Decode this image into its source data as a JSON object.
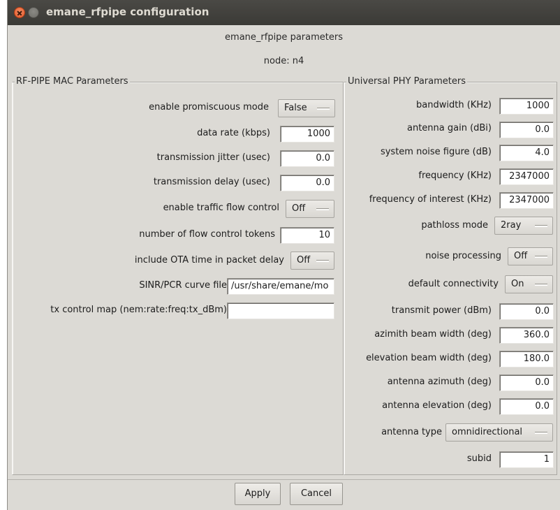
{
  "window": {
    "title": "emane_rfpipe configuration"
  },
  "header": {
    "subtitle": "emane_rfpipe parameters",
    "node": "node: n4"
  },
  "mac": {
    "title": "RF-PIPE MAC Parameters",
    "fields": [
      {
        "label": "enable promiscuous mode",
        "type": "menu",
        "value": "False"
      },
      {
        "label": "data rate (kbps)",
        "type": "entry",
        "value": "1000"
      },
      {
        "label": "transmission jitter (usec)",
        "type": "entry",
        "value": "0.0"
      },
      {
        "label": "transmission delay (usec)",
        "type": "entry",
        "value": "0.0"
      },
      {
        "label": "enable traffic flow control",
        "type": "menu",
        "value": "Off"
      },
      {
        "label": "number of flow control tokens",
        "type": "entry",
        "value": "10"
      },
      {
        "label": "include OTA time in packet delay",
        "type": "menu",
        "value": "Off"
      },
      {
        "label": "SINR/PCR curve file",
        "type": "entry",
        "value": "/usr/share/emane/mo"
      },
      {
        "label": "tx control map (nem:rate:freq:tx_dBm)",
        "type": "entry",
        "value": ""
      }
    ]
  },
  "phy": {
    "title": "Universal PHY Parameters",
    "fields": [
      {
        "label": "bandwidth (KHz)",
        "type": "entry",
        "value": "1000"
      },
      {
        "label": "antenna gain (dBi)",
        "type": "entry",
        "value": "0.0"
      },
      {
        "label": "system noise figure (dB)",
        "type": "entry",
        "value": "4.0"
      },
      {
        "label": "frequency (KHz)",
        "type": "entry",
        "value": "2347000"
      },
      {
        "label": "frequency of interest (KHz)",
        "type": "entry",
        "value": "2347000"
      },
      {
        "label": "pathloss mode",
        "type": "menu",
        "value": "2ray"
      },
      {
        "label": "noise processing",
        "type": "menu",
        "value": "Off"
      },
      {
        "label": "default connectivity",
        "type": "menu",
        "value": "On"
      },
      {
        "label": "transmit power (dBm)",
        "type": "entry",
        "value": "0.0"
      },
      {
        "label": "azimith beam width (deg)",
        "type": "entry",
        "value": "360.0"
      },
      {
        "label": "elevation beam width (deg)",
        "type": "entry",
        "value": "180.0"
      },
      {
        "label": "antenna azimuth (deg)",
        "type": "entry",
        "value": "0.0"
      },
      {
        "label": "antenna elevation (deg)",
        "type": "entry",
        "value": "0.0"
      },
      {
        "label": "antenna type",
        "type": "menu",
        "value": "omnidirectional"
      },
      {
        "label": "subid",
        "type": "entry",
        "value": "1"
      }
    ]
  },
  "buttons": {
    "apply": "Apply",
    "cancel": "Cancel"
  },
  "colors": {
    "window_bg": "#dcdad5",
    "titlebar": "#3c3b37",
    "close_button": "#e4572a"
  }
}
